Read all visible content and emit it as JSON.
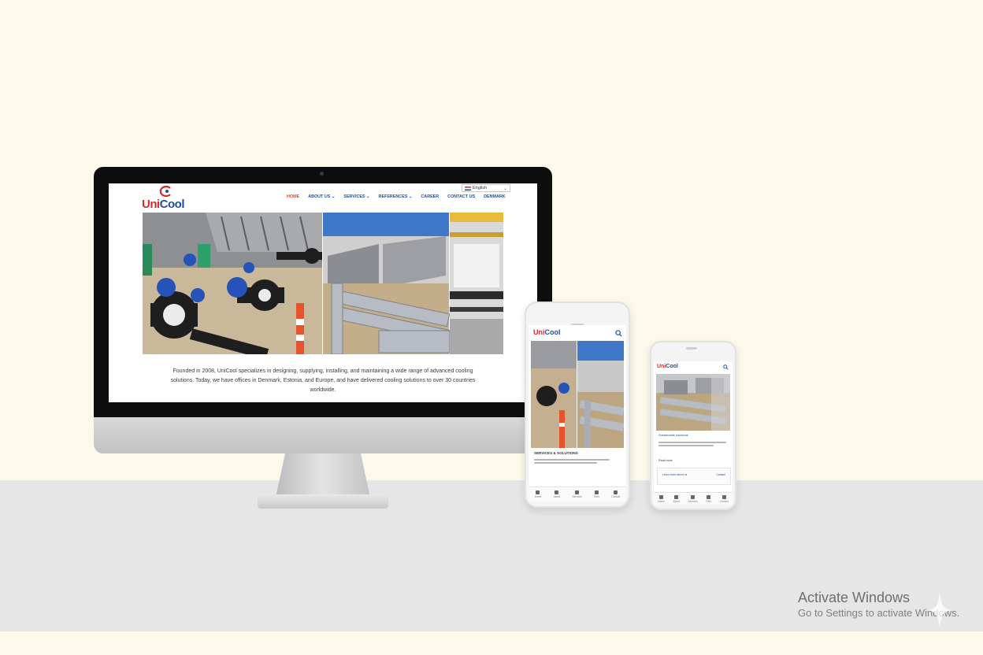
{
  "brand": {
    "logo_uni": "Uni",
    "logo_cool": "Cool",
    "accent_red": "#d62a2a",
    "accent_blue": "#1f4f9c"
  },
  "desktop": {
    "nav": [
      {
        "label": "HOME",
        "active": true
      },
      {
        "label": "ABOUT US ⌄"
      },
      {
        "label": "SERVICES ⌄"
      },
      {
        "label": "REFERENCES ⌄"
      },
      {
        "label": "CAREER"
      },
      {
        "label": "CONTACT US"
      },
      {
        "label": "DENMARK"
      }
    ],
    "language": "English",
    "hero_alt": "rooftop cooling installation with blue valves, black pipes and cooling units",
    "intro": "Founded in 2008, UniCool specializes in designing, supplying, installing, and maintaining a wide range of advanced cooling solutions. Today, we have offices in Denmark, Estonia, and Europe, and have delivered cooling solutions to over 30 countries worldwide."
  },
  "phone_large": {
    "logo_uni": "Uni",
    "logo_cool": "Cool",
    "search_icon": "search-icon",
    "section_heading": "SERVICES & SOLUTIONS",
    "bottom_nav": [
      "Home",
      "About",
      "Services",
      "Refs",
      "Contact"
    ]
  },
  "phone_small": {
    "logo_uni": "Uni",
    "logo_cool": "Cool",
    "section_heading": "Sustainable solutions",
    "read_more": "Read more",
    "link_left": "Learn more about us",
    "link_right": "Contact",
    "bottom_nav": [
      "Home",
      "About",
      "Services",
      "Refs",
      "Contact"
    ]
  },
  "watermark": {
    "title": "Activate Windows",
    "subtitle": "Go to Settings to activate Windows."
  }
}
